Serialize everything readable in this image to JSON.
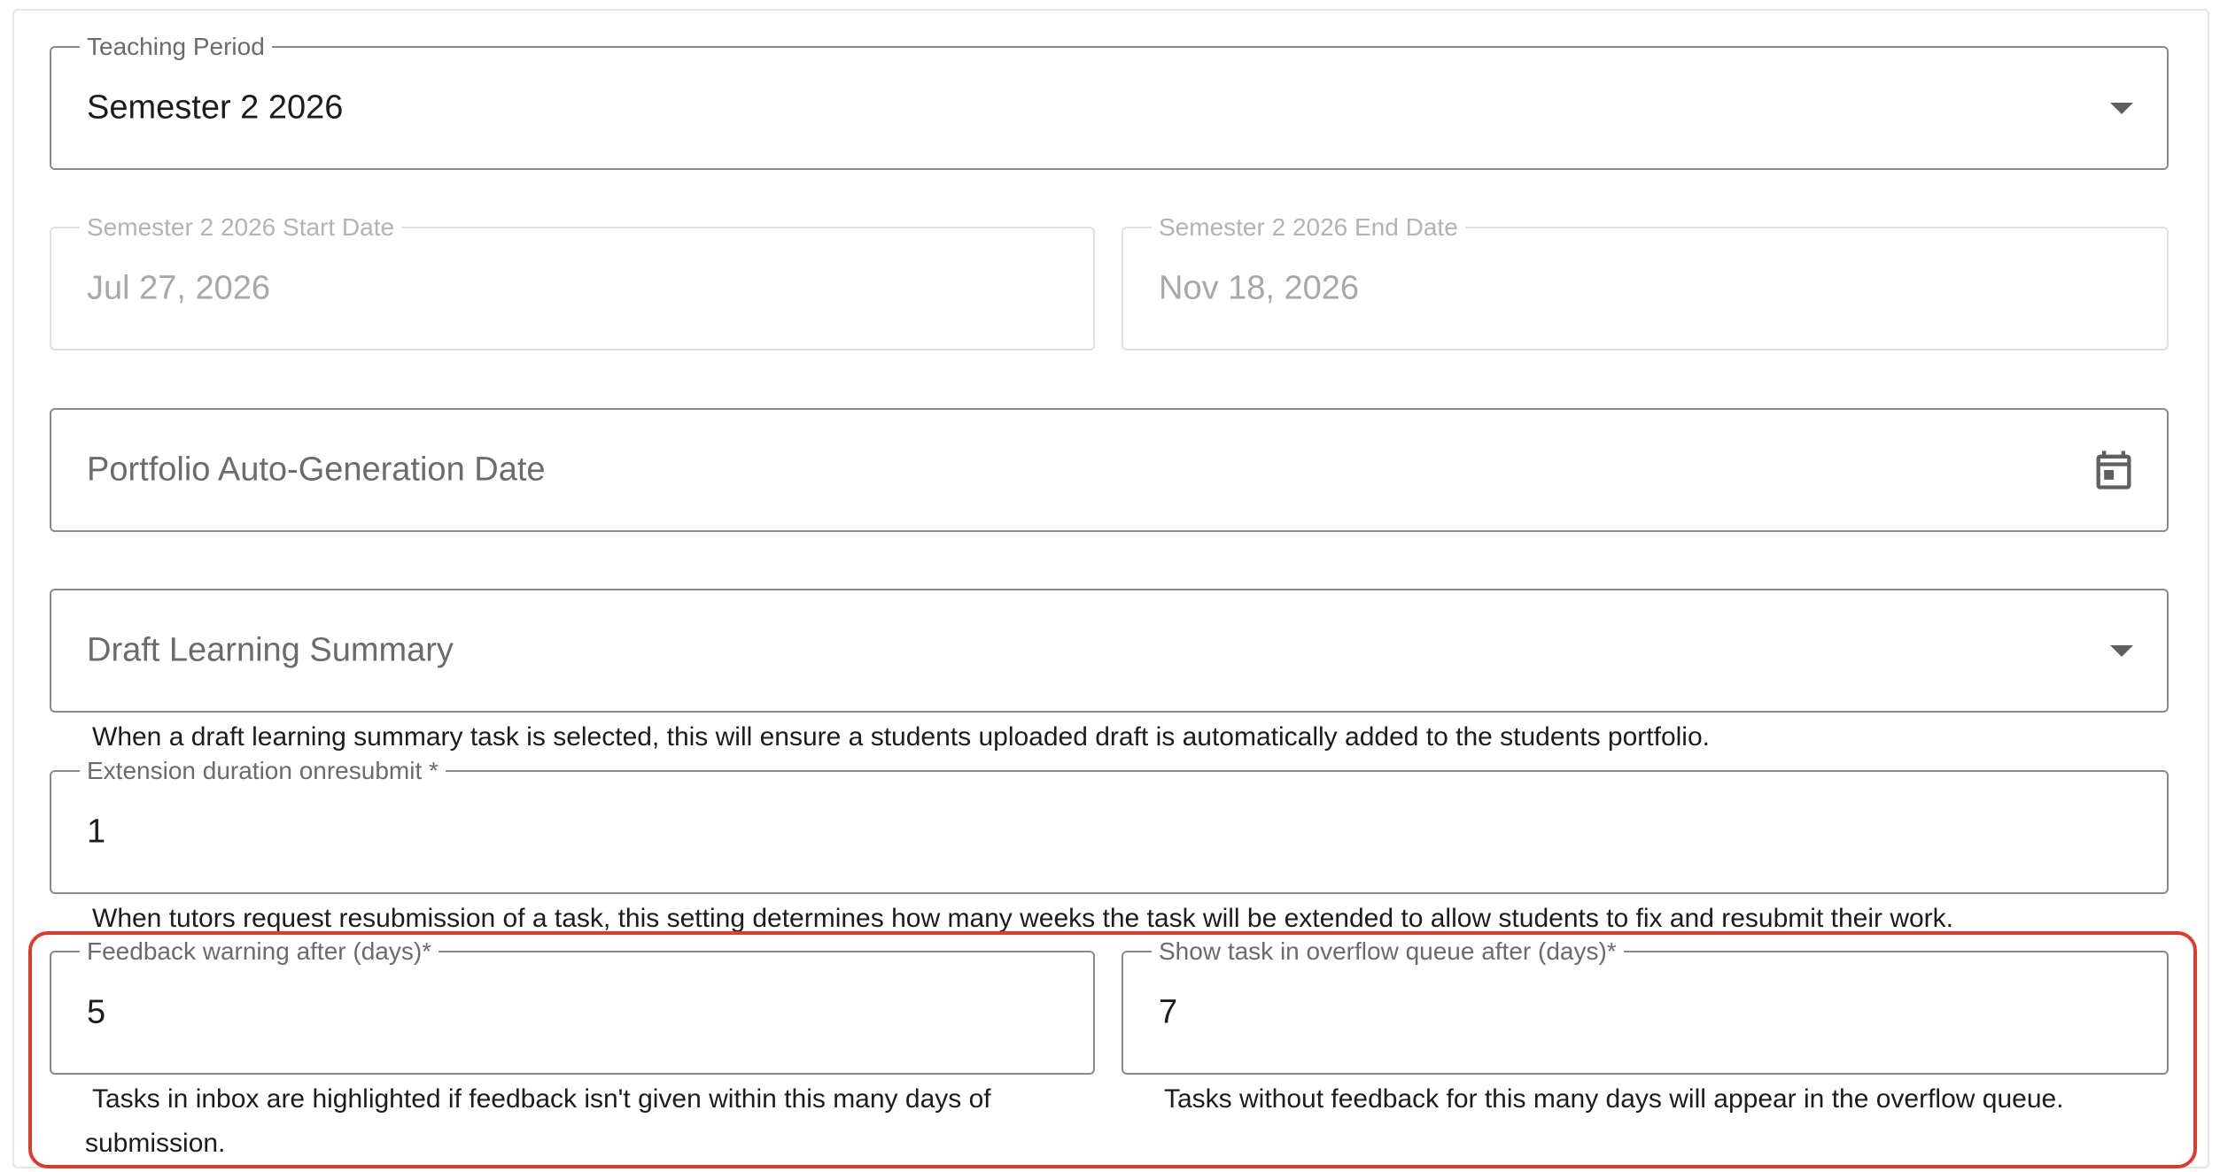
{
  "teaching_period": {
    "label": "Teaching Period",
    "value": "Semester 2 2026"
  },
  "start_date": {
    "label": "Semester 2 2026 Start Date",
    "value": "Jul 27, 2026"
  },
  "end_date": {
    "label": "Semester 2 2026 End Date",
    "value": "Nov 18, 2026"
  },
  "portfolio_date": {
    "placeholder": "Portfolio Auto-Generation Date",
    "icon": "calendar-icon"
  },
  "draft_summary": {
    "placeholder": "Draft Learning Summary",
    "hint": "When a draft learning summary task is selected, this will ensure a students uploaded draft is automatically added to the students portfolio."
  },
  "extension": {
    "label": "Extension duration onresubmit *",
    "value": "1",
    "hint": "When tutors request resubmission of a task, this setting determines how many weeks the task will be extended to allow students to fix and resubmit their work."
  },
  "feedback_warning": {
    "label": "Feedback warning after (days)*",
    "value": "5",
    "hint": "Tasks in inbox are highlighted if feedback isn't given within this many days of submission."
  },
  "overflow_queue": {
    "label": "Show task in overflow queue after (days)*",
    "value": "7",
    "hint": "Tasks without feedback for this many days will appear in the overflow queue."
  },
  "colors": {
    "highlight": "#e03a2b",
    "border": "#8a8a8a"
  }
}
